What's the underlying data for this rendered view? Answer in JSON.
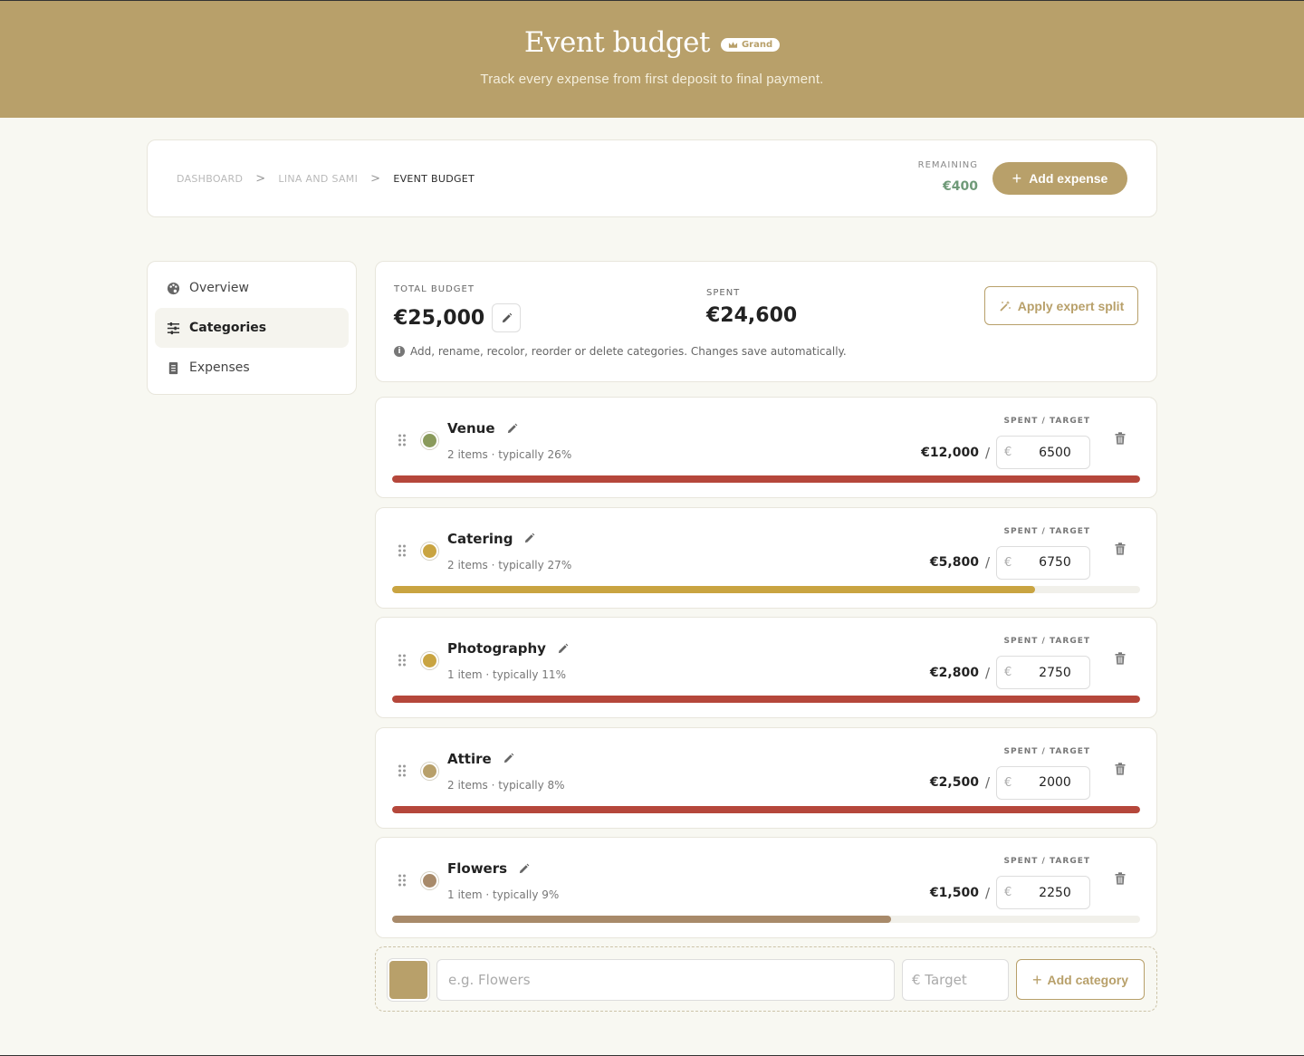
{
  "header": {
    "title": "Event budget",
    "badge": "Grand",
    "subtitle": "Track every expense from first deposit to final payment."
  },
  "breadcrumb": {
    "items": [
      "DASHBOARD",
      "LINA AND SAMI",
      "EVENT BUDGET"
    ],
    "separator": ">"
  },
  "remaining": {
    "label": "REMAINING",
    "value": "€400"
  },
  "add_expense_label": "Add expense",
  "sidebar": {
    "items": [
      {
        "label": "Overview",
        "icon": "palette-icon",
        "active": false
      },
      {
        "label": "Categories",
        "icon": "sliders-icon",
        "active": true
      },
      {
        "label": "Expenses",
        "icon": "receipt-icon",
        "active": false
      }
    ]
  },
  "summary": {
    "total_label": "TOTAL BUDGET",
    "total_value": "€25,000",
    "spent_label": "SPENT",
    "spent_value": "€24,600",
    "expert_button": "Apply expert split",
    "hint": "Add, rename, recolor, reorder or delete categories. Changes save automatically."
  },
  "spent_target_label": "SPENT / TARGET",
  "currency_symbol": "€",
  "categories": [
    {
      "name": "Venue",
      "meta": "2 items · typically 26%",
      "spent": "€12,000",
      "target": "6500",
      "color": "#8a9a5b",
      "bar_color": "#b5473b",
      "progress": 1.0
    },
    {
      "name": "Catering",
      "meta": "2 items · typically 27%",
      "spent": "€5,800",
      "target": "6750",
      "color": "#c9a441",
      "bar_color": "#c9a441",
      "progress": 0.86
    },
    {
      "name": "Photography",
      "meta": "1 item · typically 11%",
      "spent": "€2,800",
      "target": "2750",
      "color": "#c9a441",
      "bar_color": "#b5473b",
      "progress": 1.0
    },
    {
      "name": "Attire",
      "meta": "2 items · typically 8%",
      "spent": "€2,500",
      "target": "2000",
      "color": "#b8a06a",
      "bar_color": "#b5473b",
      "progress": 1.0
    },
    {
      "name": "Flowers",
      "meta": "1 item · typically 9%",
      "spent": "€1,500",
      "target": "2250",
      "color": "#a88a6a",
      "bar_color": "#a88a6a",
      "progress": 0.667
    }
  ],
  "new_category": {
    "color": "#b8a06a",
    "name_placeholder": "e.g. Flowers",
    "target_placeholder": "€ Target",
    "button_label": "Add category"
  }
}
